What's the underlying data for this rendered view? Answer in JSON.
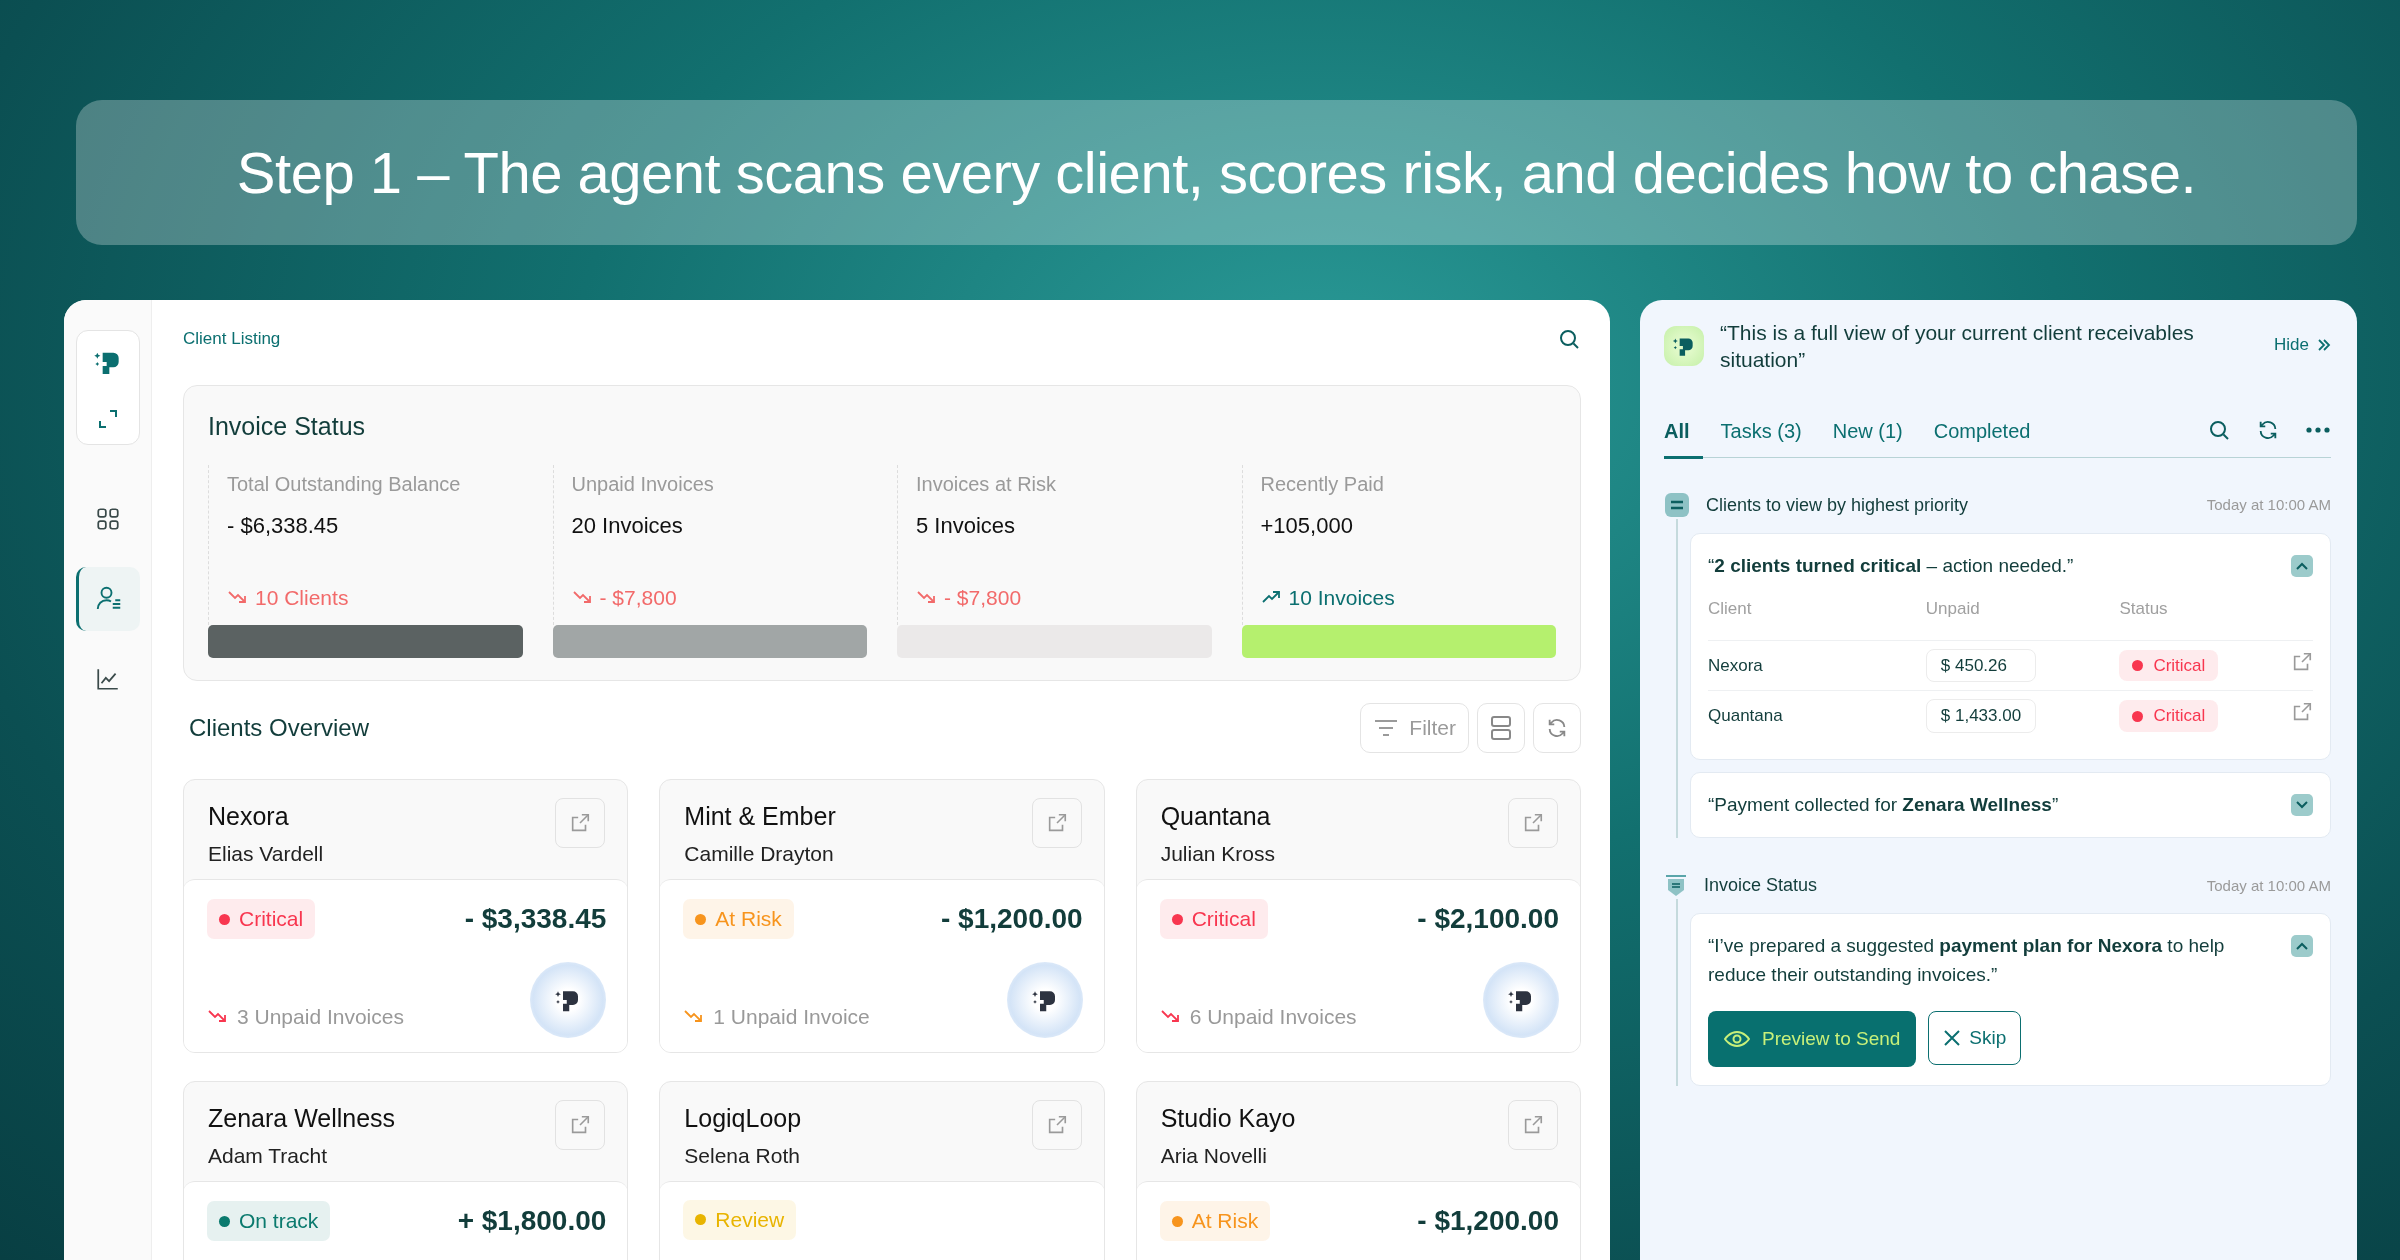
{
  "banner": {
    "text": "Step 1 – The agent scans every client, scores risk, and decides how to chase."
  },
  "sidebar": {
    "items": [
      {
        "kind": "grid",
        "selected": false
      },
      {
        "kind": "clients",
        "selected": true
      },
      {
        "kind": "chart",
        "selected": false
      }
    ]
  },
  "header": {
    "breadcrumb": "Client Listing"
  },
  "invoice_status": {
    "title": "Invoice Status",
    "metrics": [
      {
        "label": "Total Outstanding Balance",
        "value": "- $6,338.45",
        "trend": "10 Clients",
        "rising": false,
        "color": "#5b6262"
      },
      {
        "label": "Unpaid Invoices",
        "value": "20 Invoices",
        "trend": "- $7,800",
        "rising": false,
        "color": "#a1a6a6"
      },
      {
        "label": "Invoices at Risk",
        "value": "5 Invoices",
        "trend": "- $7,800",
        "rising": false,
        "color": "#ebe9e9"
      },
      {
        "label": "Recently Paid",
        "value": "+105,000",
        "trend": "10 Invoices",
        "rising": true,
        "color": "#b5f06e"
      }
    ]
  },
  "clients_overview": {
    "title": "Clients Overview",
    "filter_label": "Filter",
    "clients": [
      {
        "name": "Nexora",
        "contact": "Elias Vardell",
        "status": "Critical",
        "color": "#f8364f",
        "amount": "- $3,338.45",
        "invoices": "3 Unpaid Invoices"
      },
      {
        "name": "Mint & Ember",
        "contact": "Camille Drayton",
        "status": "At Risk",
        "color": "#f7941d",
        "amount": "- $1,200.00",
        "invoices": "1 Unpaid Invoice"
      },
      {
        "name": "Quantana",
        "contact": "Julian Kross",
        "status": "Critical",
        "color": "#f8364f",
        "amount": "- $2,100.00",
        "invoices": "6 Unpaid Invoices"
      },
      {
        "name": "Zenara Wellness",
        "contact": "Adam Tracht",
        "status": "On track",
        "color": "#0b7a6e",
        "amount": "+ $1,800.00"
      },
      {
        "name": "LogiqLoop",
        "contact": "Selena Roth",
        "status": "Review",
        "color": "#e8b400"
      },
      {
        "name": "Studio Kayo",
        "contact": "Aria Novelli",
        "status": "At Risk",
        "color": "#f7941d",
        "amount": "- $1,200.00"
      }
    ]
  },
  "assistant": {
    "message": "“This is a full view of your current client receivables situation”",
    "hide_label": "Hide",
    "tabs": [
      {
        "label": "All",
        "selected": true
      },
      {
        "label": "Tasks (3)",
        "selected": false
      },
      {
        "label": "New (1)",
        "selected": false
      },
      {
        "label": "Completed",
        "selected": false
      }
    ],
    "sections": [
      {
        "kind": "priority",
        "title": "Clients to view by highest priority",
        "time": "Today at 10:00 AM",
        "cards": [
          {
            "message": "“**2 clients turned critical** – action needed.”",
            "expanded": true,
            "table": {
              "columns": [
                "Client",
                "Unpaid",
                "Status"
              ],
              "rows": [
                {
                  "client": "Nexora",
                  "unpaid": "$ 450.26",
                  "status": "Critical",
                  "color": "#f8364f"
                },
                {
                  "client": "Quantana",
                  "unpaid": "$ 1,433.00",
                  "status": "Critical",
                  "color": "#f8364f"
                }
              ]
            }
          },
          {
            "message": "“Payment collected for **Zenara Wellness**”",
            "expanded": false
          }
        ]
      },
      {
        "kind": "invoice",
        "title": "Invoice Status",
        "time": "Today at 10:00 AM",
        "cards": [
          {
            "message": "“I’ve prepared a suggested **payment plan for Nexora**  to help reduce their outstanding invoices.”",
            "expanded": true,
            "buttons": [
              {
                "label": "Preview to Send",
                "kind": "primary"
              },
              {
                "label": "Skip",
                "kind": "secondary"
              }
            ]
          }
        ]
      }
    ]
  }
}
